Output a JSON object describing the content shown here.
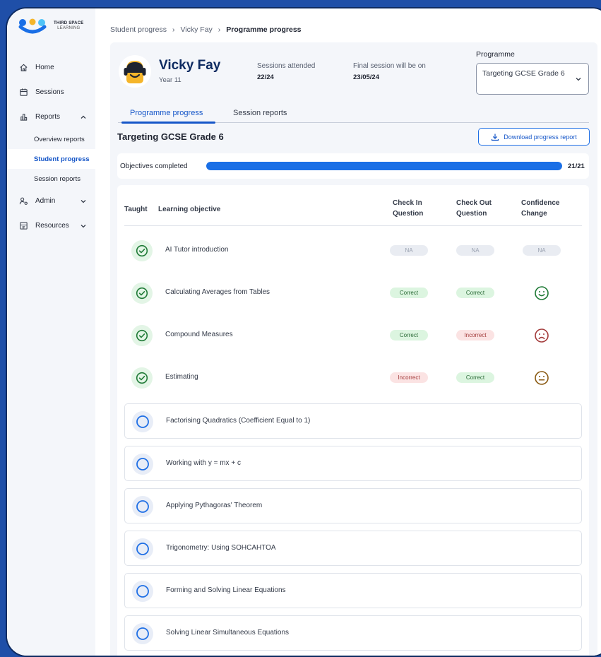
{
  "brand": {
    "name_line1": "THIRD SPACE",
    "name_line2": "LEARNING",
    "colors": {
      "blue": "#1556c8",
      "yellow": "#f5b52a",
      "navy": "#0e2b61"
    }
  },
  "sidebar": {
    "items": [
      {
        "label": "Home",
        "icon": "home-icon"
      },
      {
        "label": "Sessions",
        "icon": "calendar-icon"
      },
      {
        "label": "Reports",
        "icon": "chart-icon",
        "expanded": true,
        "children": [
          {
            "label": "Overview reports"
          },
          {
            "label": "Student progress",
            "active": true
          },
          {
            "label": "Session reports"
          }
        ]
      },
      {
        "label": "Admin",
        "icon": "admin-icon"
      },
      {
        "label": "Resources",
        "icon": "resources-icon"
      }
    ]
  },
  "breadcrumb": [
    "Student progress",
    "Vicky Fay",
    "Programme progress"
  ],
  "student": {
    "name": "Vicky Fay",
    "year": "Year 11",
    "sessions_label": "Sessions attended",
    "sessions_value": "22/24",
    "final_label": "Final session will be on",
    "final_value": "23/05/24"
  },
  "programme": {
    "label": "Programme",
    "selected": "Targeting GCSE Grade 6"
  },
  "tabs": [
    {
      "label": "Programme progress",
      "active": true
    },
    {
      "label": "Session reports",
      "active": false
    }
  ],
  "section": {
    "title": "Targeting GCSE Grade 6",
    "download_label": "Download progress report",
    "objectives_label": "Objectives completed",
    "objectives_count": "21/21",
    "objectives_fraction": 1.0
  },
  "table": {
    "headers": {
      "taught": "Taught",
      "objective": "Learning objective",
      "check_in_1": "Check In",
      "check_in_2": "Question",
      "check_out_1": "Check Out",
      "check_out_2": "Question",
      "confidence_1": "Confidence",
      "confidence_2": "Change"
    },
    "rows": [
      {
        "label": "AI Tutor introduction",
        "taught": true,
        "check_in": "NA",
        "check_out": "NA",
        "confidence": "NA"
      },
      {
        "label": "Calculating Averages from Tables",
        "taught": true,
        "check_in": "Correct",
        "check_out": "Correct",
        "confidence": "happy"
      },
      {
        "label": "Compound Measures",
        "taught": true,
        "check_in": "Correct",
        "check_out": "Incorrect",
        "confidence": "sad"
      },
      {
        "label": "Estimating",
        "taught": true,
        "check_in": "Incorrect",
        "check_out": "Correct",
        "confidence": "neutral"
      },
      {
        "label": "Factorising Quadratics (Coefficient Equal to 1)",
        "taught": false
      },
      {
        "label": "Working with y = mx + c",
        "taught": false
      },
      {
        "label": "Applying Pythagoras' Theorem",
        "taught": false
      },
      {
        "label": "Trigonometry: Using SOHCAHTOA",
        "taught": false
      },
      {
        "label": "Forming and Solving Linear Equations",
        "taught": false
      },
      {
        "label": "Solving Linear Simultaneous Equations",
        "taught": false
      }
    ]
  }
}
